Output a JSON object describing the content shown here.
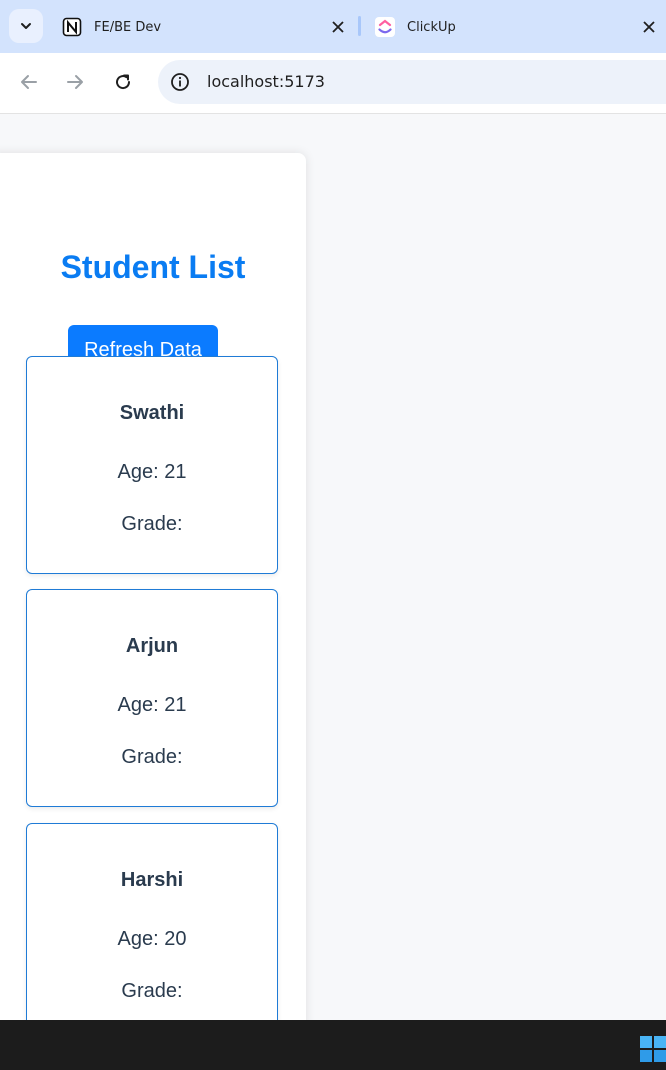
{
  "browser": {
    "tabs": [
      {
        "title": "FE/BE Dev",
        "favicon": "notion-icon"
      },
      {
        "title": "ClickUp",
        "favicon": "clickup-icon"
      }
    ],
    "url": "localhost:5173"
  },
  "page": {
    "title": "Student List",
    "refresh_label": "Refresh Data",
    "students": [
      {
        "name": "Swathi",
        "age": "Age: 21",
        "grade": "Grade:"
      },
      {
        "name": "Arjun",
        "age": "Age: 21",
        "grade": "Grade:"
      },
      {
        "name": "Harshi",
        "age": "Age: 20",
        "grade": "Grade:"
      }
    ]
  },
  "colors": {
    "accent": "#0b7bff",
    "title": "#0a7cf2",
    "card_border": "#1f7bd6",
    "tab_strip": "#d3e3fd"
  }
}
